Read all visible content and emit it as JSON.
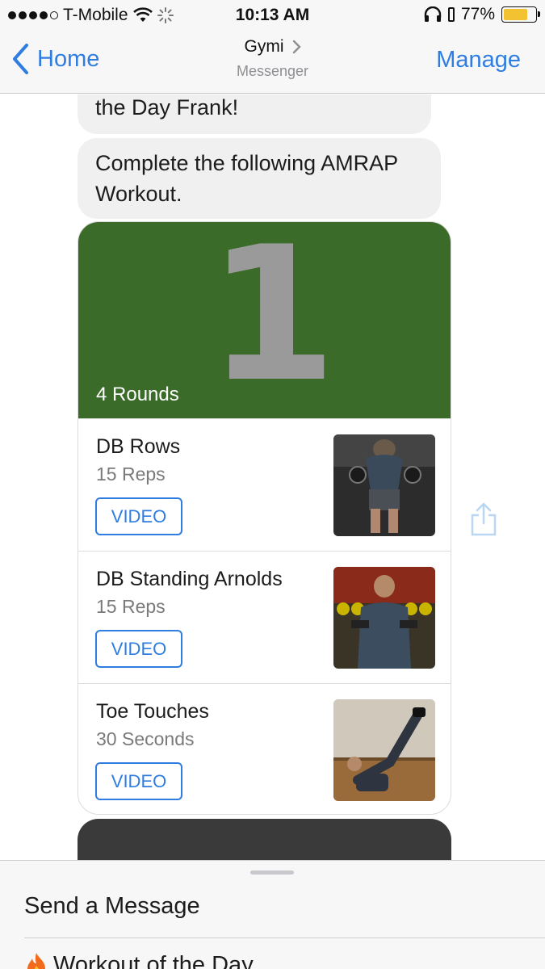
{
  "status_bar": {
    "carrier": "T-Mobile",
    "time": "10:13 AM",
    "battery": "77%",
    "battery_level": 0.77,
    "icons": [
      "signal-dots-icon",
      "wifi-icon",
      "activity-spinner-icon",
      "headphones-icon",
      "battery-icon"
    ]
  },
  "nav": {
    "back_label": "Home",
    "title": "Gymi",
    "subtitle": "Messenger",
    "action_label": "Manage",
    "accent_color": "#2f7de1"
  },
  "messages": [
    {
      "text": "the Day Frank!"
    },
    {
      "text": "Complete the following AMRAP Workout."
    }
  ],
  "workout": {
    "number": "1",
    "rounds_label": "4 Rounds",
    "header_color": "#3a6b28",
    "exercises": [
      {
        "name": "DB Rows",
        "detail": "15 Reps",
        "button": "VIDEO"
      },
      {
        "name": "DB Standing Arnolds",
        "detail": "15 Reps",
        "button": "VIDEO"
      },
      {
        "name": "Toe Touches",
        "detail": "30 Seconds",
        "button": "VIDEO"
      }
    ]
  },
  "composer": {
    "placeholder": "Send a Message",
    "quick_reply": "Workout of the Day",
    "quick_reply_icon": "fire-icon"
  }
}
